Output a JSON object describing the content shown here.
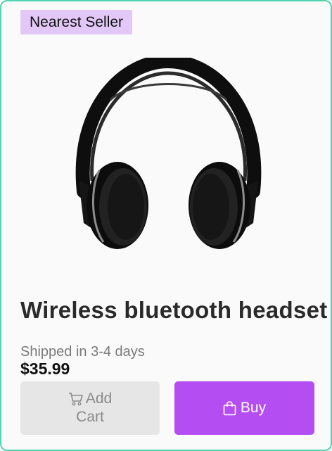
{
  "badge": {
    "label": "Nearest Seller",
    "color": "#e3c8f7"
  },
  "product": {
    "image_icon": "headphones-image",
    "title": "Wireless bluetooth headset",
    "shipping": "Shipped in 3-4 days",
    "price": "$35.99"
  },
  "actions": {
    "add_to_cart": {
      "icon": "cart-icon",
      "label_line1": "Add",
      "label_line2": "Cart"
    },
    "buy": {
      "icon": "shopping-bag-icon",
      "label": "Buy",
      "color": "#b54ef2"
    }
  },
  "theme": {
    "border_color": "#4fd6b0"
  }
}
